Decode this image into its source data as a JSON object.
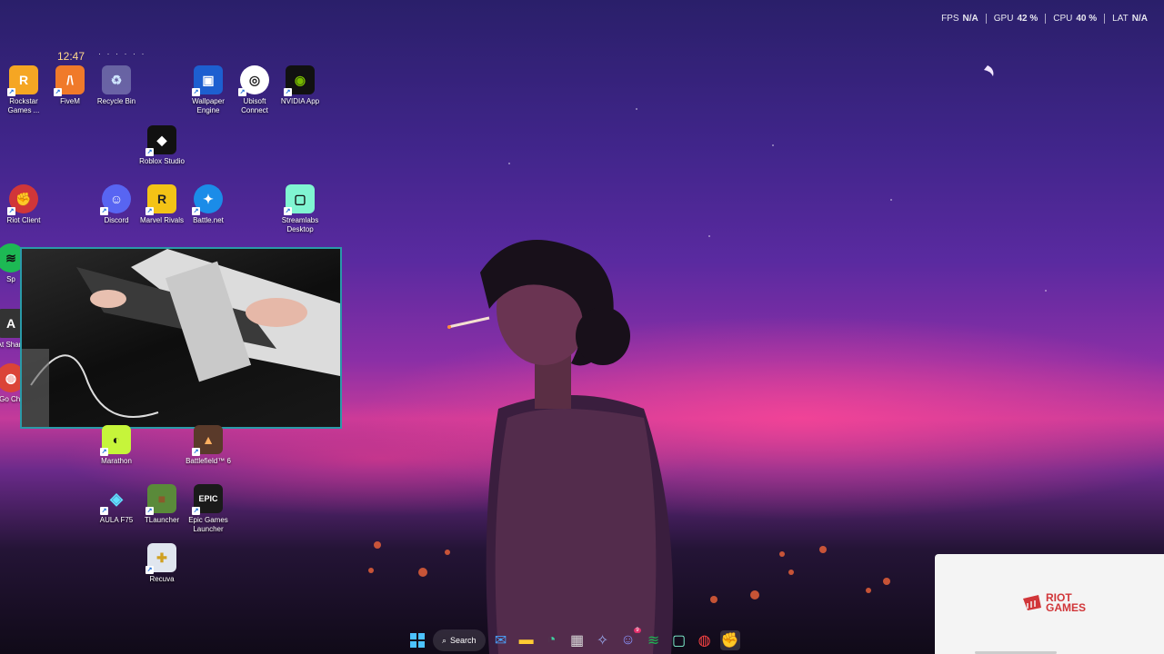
{
  "overlay": {
    "stats": [
      {
        "key": "FPS",
        "value": "N/A"
      },
      {
        "key": "GPU",
        "value": "42 %"
      },
      {
        "key": "CPU",
        "value": "40 %"
      },
      {
        "key": "LAT",
        "value": "N/A"
      }
    ]
  },
  "desktop": {
    "clock": "12:47",
    "icons": {
      "rockstar": "Rockstar Games ...",
      "fivem": "FiveM",
      "recycle_bin": "Recycle Bin",
      "wallpaper_engine": "Wallpaper Engine",
      "ubisoft": "Ubisoft Connect",
      "nvidia": "NVIDIA App",
      "roblox": "Roblox Studio",
      "riot": "Riot Client",
      "discord": "Discord",
      "marvel": "Marvel Rivals",
      "battlenet": "Battle.net",
      "streamlabs": "Streamlabs Desktop",
      "spotify_partial": "Sp",
      "atk_partial": "At Shark",
      "chrome_partial": "Go Chr",
      "marathon": "Marathon",
      "battlefield": "Battlefield™ 6",
      "aula": "AULA F75",
      "tlauncher": "TLauncher",
      "epic": "Epic Games Launcher",
      "recuva": "Recuva"
    }
  },
  "riot_panel": {
    "line1": "RIOT",
    "line2": "GAMES"
  },
  "taskbar": {
    "search_label": "Search",
    "discord_badge": "9"
  },
  "colors": {
    "accent_riot": "#d13639",
    "webcam_border": "#2a9aa8"
  }
}
